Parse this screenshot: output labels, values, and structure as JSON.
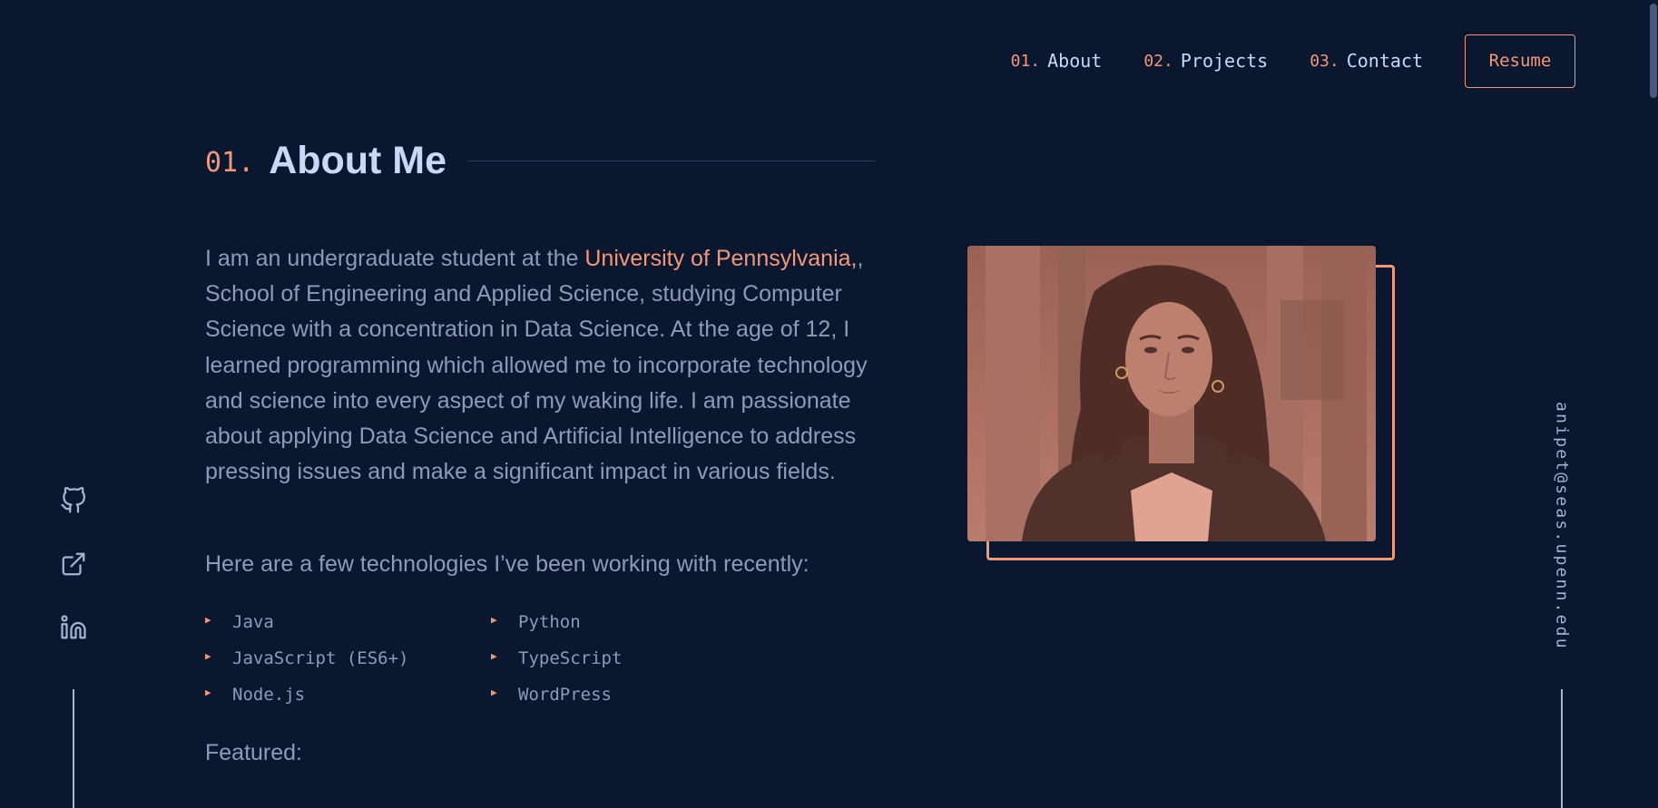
{
  "nav": {
    "items": [
      {
        "num": "01.",
        "label": "About"
      },
      {
        "num": "02.",
        "label": "Projects"
      },
      {
        "num": "03.",
        "label": "Contact"
      }
    ],
    "resume_label": "Resume"
  },
  "section": {
    "num": "01.",
    "title": "About Me"
  },
  "about": {
    "intro_before": "I am an undergraduate student at the ",
    "university_link": "University of Pennsylvania,",
    "intro_after": ", School of Engineering and Applied Science, studying Computer Science with a concentration in Data Science. At the age of 12, I learned programming which allowed me to incorporate technology and science into every aspect of my waking life. I am passionate about applying Data Science and Artificial Intelligence to address pressing issues and make a significant impact in various fields.",
    "tech_intro": "Here are a few technologies I’ve been working with recently:",
    "skills": [
      "Java",
      "Python",
      "JavaScript (ES6+)",
      "TypeScript",
      "Node.js",
      "WordPress"
    ],
    "featured": "Featured:"
  },
  "social": {
    "icons": [
      "github-icon",
      "external-link-icon",
      "linkedin-icon"
    ]
  },
  "email": "anipet@seas.upenn.edu",
  "colors": {
    "background": "#0b172f",
    "accent": "#f0987c",
    "text": "#8d9bb8",
    "heading": "#ccd6f6"
  }
}
